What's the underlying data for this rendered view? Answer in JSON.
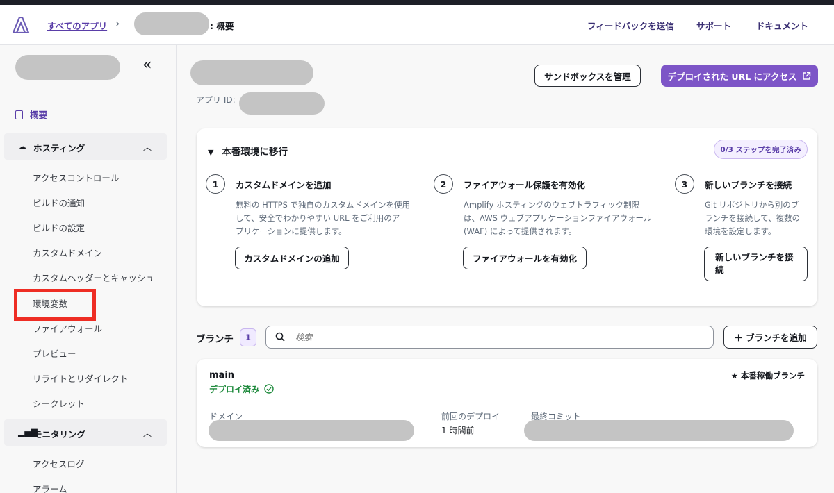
{
  "header": {
    "breadcrumb_all_apps": "すべてのアプリ",
    "breadcrumb_sep": "›",
    "breadcrumb_current": ": 概要",
    "nav": [
      "フィードバックを送信",
      "サポート",
      "ドキュメント"
    ]
  },
  "sidebar": {
    "collapse_glyph": "«",
    "overview": "概要",
    "hosting": {
      "label": "ホスティング",
      "items": [
        "アクセスコントロール",
        "ビルドの通知",
        "ビルドの設定",
        "カスタムドメイン",
        "カスタムヘッダーとキャッシュ",
        "環境変数",
        "ファイアウォール",
        "プレビュー",
        "リライトとリダイレクト",
        "シークレット"
      ]
    },
    "monitoring": {
      "label": "モニタリング",
      "items": [
        "アクセスログ",
        "アラーム"
      ]
    }
  },
  "main": {
    "manage_sandbox_button": "サンドボックスを管理",
    "visit_url_button": "デプロイされた URL にアクセス",
    "app_id_label": "アプリ ID:",
    "migrate_card": {
      "title": "本番環境に移行",
      "progress_badge": "0/3 ステップを完了済み",
      "steps": [
        {
          "num": "1",
          "title": "カスタムドメインを追加",
          "desc_lines": [
            "無料の HTTPS で独自のカスタムドメインを使用",
            "して、安全でわかりやすい URL をご利用のア",
            "プリケーションに提供します。"
          ],
          "button_lines": [
            "カスタムドメインの追加"
          ]
        },
        {
          "num": "2",
          "title": "ファイアウォール保護を有効化",
          "desc_lines": [
            "Amplify ホスティングのウェブトラフィック制限",
            "は、AWS ウェブアプリケーションファイアウォール",
            "(WAF) によって提供されます。"
          ],
          "button_lines": [
            "ファイアウォールを有効化"
          ]
        },
        {
          "num": "3",
          "title": "新しいブランチを接続",
          "desc_lines": [
            "Git リポジトリから別のブ",
            "ランチを接続して、複数の",
            "環境を設定します。"
          ],
          "button_lines": [
            "新しいブランチを接",
            "続"
          ]
        }
      ]
    },
    "branches": {
      "title": "ブランチ",
      "count": "1",
      "search_placeholder": "検索",
      "add_button": "＋ ブランチを追加",
      "items": [
        {
          "name": "main",
          "status": "デプロイ済み",
          "production_label": "★ 本番稼働ブランチ",
          "domain_label": "ドメイン",
          "last_deploy_label": "前回のデプロイ",
          "last_deploy_value": "1 時間前",
          "last_commit_label": "最終コミット"
        }
      ]
    }
  },
  "colors": {
    "accent": "#7d55c7",
    "link": "#5a3ea8",
    "success": "#1e8a3c",
    "highlight_box": "#ee2d24"
  }
}
